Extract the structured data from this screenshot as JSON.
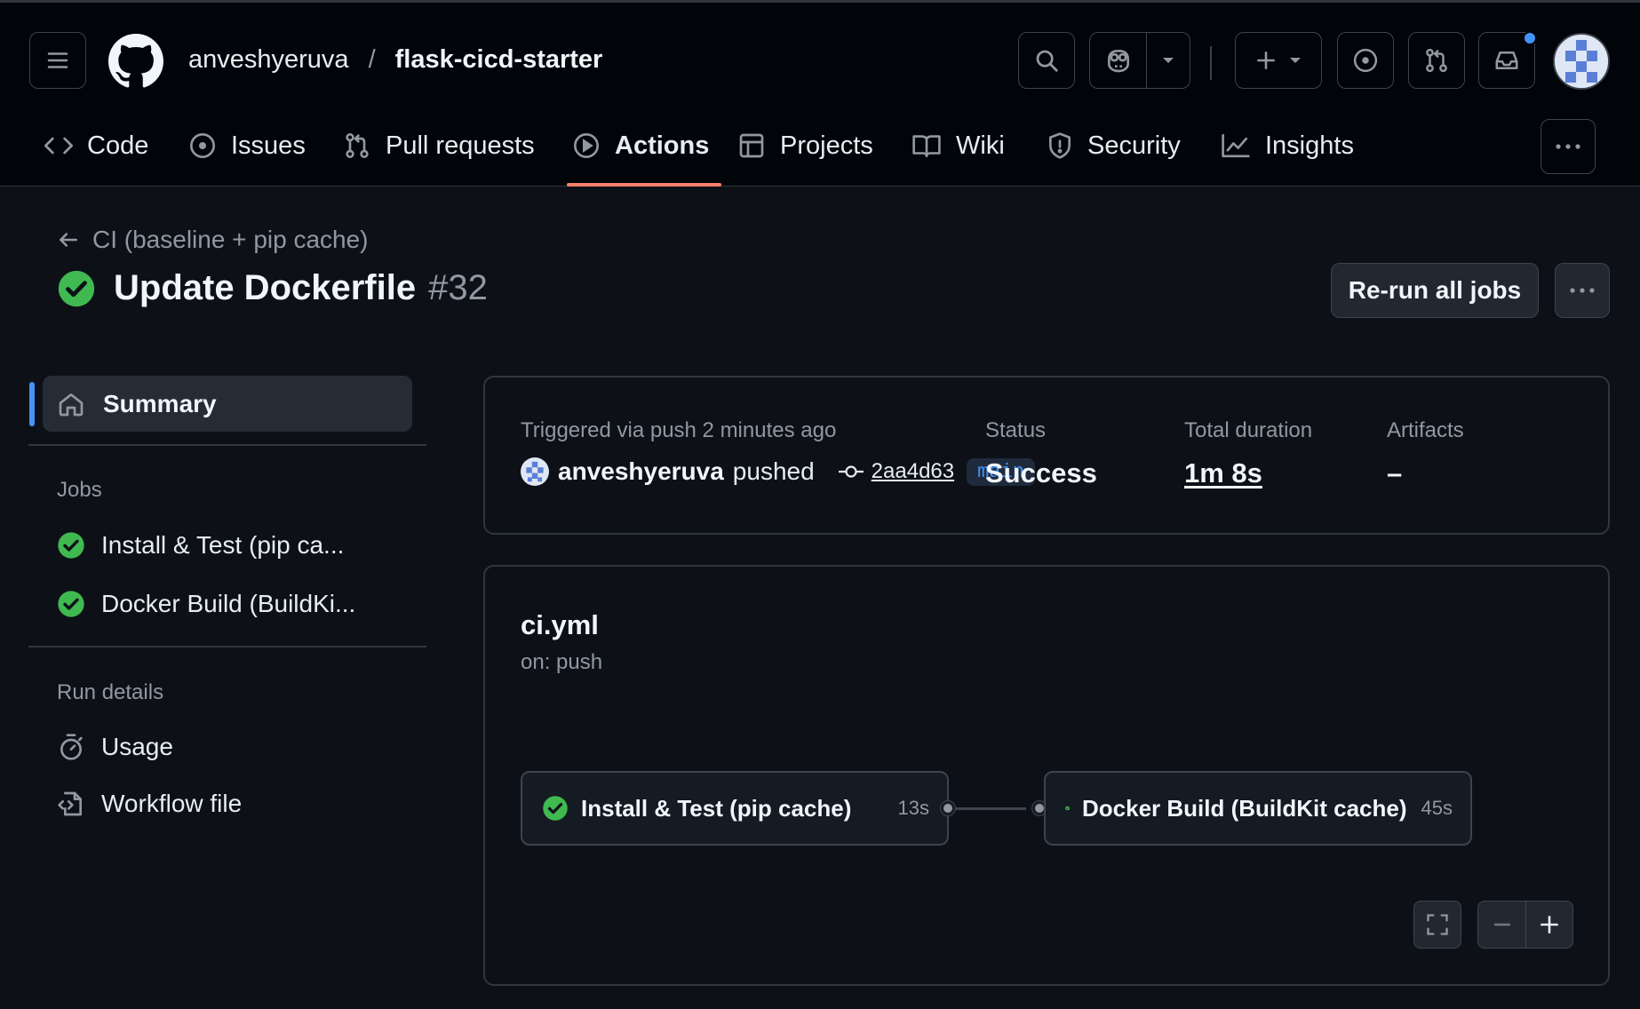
{
  "repo": {
    "owner": "anveshyeruva",
    "separator": "/",
    "name": "flask-cicd-starter"
  },
  "tabs": [
    {
      "label": "Code",
      "icon": "code-icon"
    },
    {
      "label": "Issues",
      "icon": "issue-opened-icon"
    },
    {
      "label": "Pull requests",
      "icon": "git-pull-request-icon"
    },
    {
      "label": "Actions",
      "icon": "play-icon",
      "active": true
    },
    {
      "label": "Projects",
      "icon": "table-icon"
    },
    {
      "label": "Wiki",
      "icon": "book-icon"
    },
    {
      "label": "Security",
      "icon": "shield-icon"
    },
    {
      "label": "Insights",
      "icon": "graph-icon"
    }
  ],
  "run": {
    "workflow_back": "CI (baseline + pip cache)",
    "title": "Update Dockerfile",
    "number": "#32",
    "rerun_label": "Re-run all jobs",
    "status_color": "#3fb950"
  },
  "sidebar": {
    "summary_label": "Summary",
    "jobs_heading": "Jobs",
    "jobs": [
      {
        "label": "Install & Test (pip ca..."
      },
      {
        "label": "Docker Build (BuildKi..."
      }
    ],
    "run_details_heading": "Run details",
    "details": [
      {
        "label": "Usage",
        "icon": "stopwatch-icon"
      },
      {
        "label": "Workflow file",
        "icon": "file-code-icon"
      }
    ]
  },
  "summary": {
    "triggered": "Triggered via push 2 minutes ago",
    "actor": "anveshyeruva",
    "action": "pushed",
    "commit_sha": "2aa4d63",
    "branch": "main",
    "status_label": "Status",
    "status_value": "Success",
    "duration_label": "Total duration",
    "duration_value": "1m 8s",
    "artifacts_label": "Artifacts",
    "artifacts_value": "–"
  },
  "workflow_graph": {
    "file": "ci.yml",
    "trigger": "on: push",
    "jobs": [
      {
        "name": "Install & Test (pip cache)",
        "duration": "13s"
      },
      {
        "name": "Docker Build (BuildKit cache)",
        "duration": "45s"
      }
    ]
  },
  "colors": {
    "accent": "#4493f8",
    "success": "#3fb950",
    "active_tab_underline": "#f78166"
  }
}
